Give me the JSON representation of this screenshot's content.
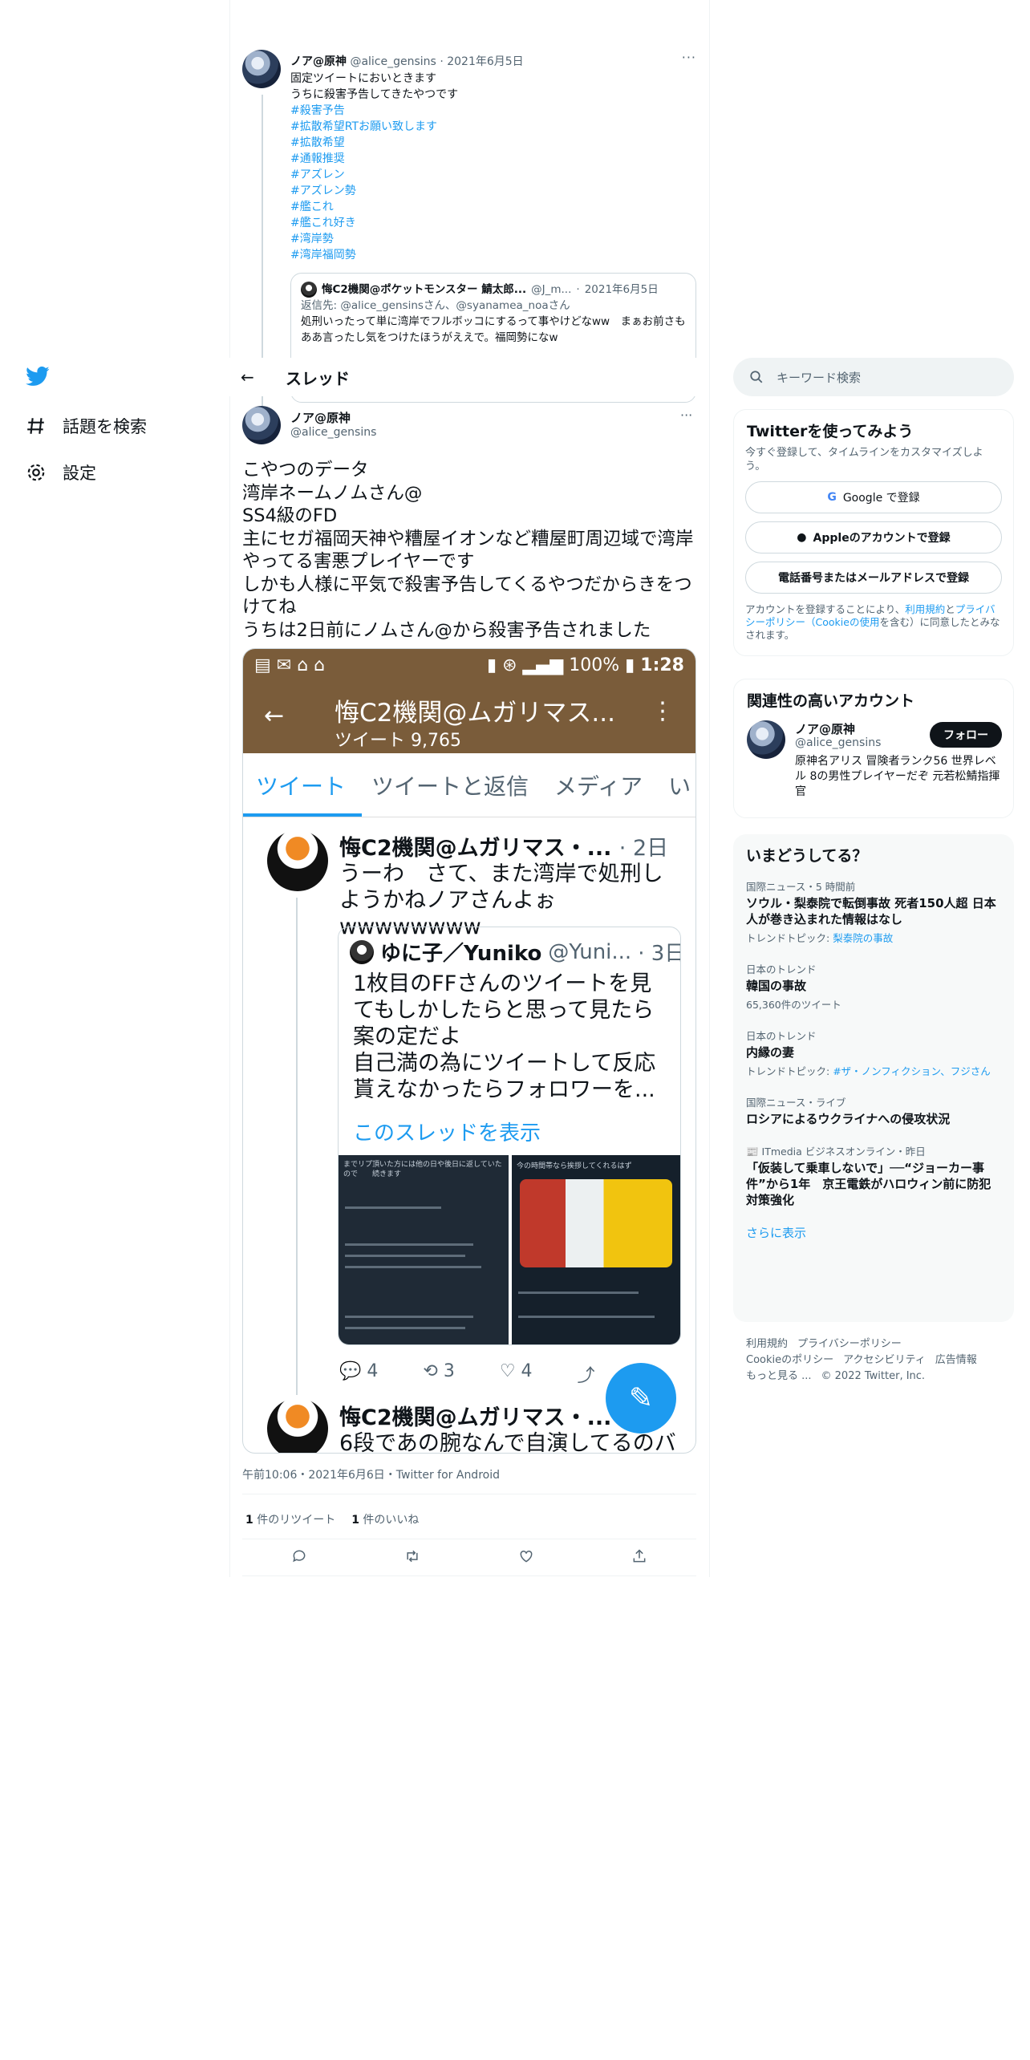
{
  "nav": {
    "items": [
      {
        "label": "話題を検索",
        "icon": "hashtag-icon"
      },
      {
        "label": "設定",
        "icon": "gear-icon"
      }
    ]
  },
  "pinned": {
    "name": "ノア@原神",
    "handle": "@alice_gensins",
    "date": "2021年6月5日",
    "more": "···",
    "lines": [
      "固定ツイートにおいときます",
      "うちに殺害予告してきたやつです"
    ],
    "hashtags": [
      "#殺害予告",
      "#拡散希望RTお願い致します",
      "#拡散希望",
      "#通報推奨",
      "#アズレン",
      "#アズレン勢",
      "#艦これ",
      "#艦これ好き",
      "#湾岸勢",
      "#湾岸福岡勢"
    ],
    "quote": {
      "name": "悔C2機関@ポケットモンスター 鯖太郎...",
      "handle": "@J_m...",
      "date": "2021年6月5日",
      "reply_prefix": "返信先:",
      "reply_to": "@alice_gensinsさん、@syanamea_noaさん",
      "text": "処刑いったって単に湾岸でフルボッコにするって事やけどなww　まぁお前さもああ言ったし気をつけたほうがええで。福岡勢になw"
    }
  },
  "header": {
    "title": "スレッド"
  },
  "main": {
    "name": "ノア@原神",
    "handle": "@alice_gensins",
    "more": "···",
    "text": "こやつのデータ\n湾岸ネームノムさん@\nSS4級のFD\n主にセガ福岡天神や糟屋イオンなど糟屋町周辺域で湾岸やってる害悪プレイヤーです\nしかも人様に平気で殺害予告してくるやつだからきをつけてね\nうちは2日前にノムさん@から殺害予告されました",
    "timestamp": "午前10:06・2021年6月6日・Twitter for Android",
    "retweets": "1",
    "retweets_label": "件のリツイート",
    "likes": "1",
    "likes_label": "件のいいね"
  },
  "screenshot": {
    "battery": "100%",
    "time": "1:28",
    "title": "悔C2機関@ムガリマス...",
    "subtitle": "ツイート 9,765",
    "tabs": [
      "ツイート",
      "ツイートと返信",
      "メディア",
      "い"
    ],
    "tweet_name": "悔C2機関@ムガリマス・...",
    "tweet_age": "· 2日",
    "tweet_text": "うーわ　さて、また湾岸で処刑しようかねノアさんよぉwwwwwwww",
    "quote_name": "ゆに子／Yuniko",
    "quote_handle": "@Yuni...",
    "quote_age": "· 3日",
    "quote_text": "1枚目のFFさんのツイートを見てもしかしたらと思って見たら案の定だよ\n自己満の為にツイートして反応貰えなかったらフォロワーを...",
    "quote_link": "このスレッドを表示",
    "img1_caption": "までリプ頂いた方には他の日や後日に返していたので　　続きます",
    "img2_caption": "今の時間帯なら挨拶してくれるはず",
    "replies": "4",
    "rts": "3",
    "likes": "4",
    "next_name": "悔C2機関@ムガリマス・...",
    "next_text": "6段であの腕なんで自演してるのバ"
  },
  "search": {
    "placeholder": "キーワード検索"
  },
  "signup": {
    "title": "Twitterを使ってみよう",
    "subtitle": "今すぐ登録して、タイムラインをカスタマイズしよう。",
    "google": "Google で登録",
    "apple": "Appleのアカウントで登録",
    "phone": "電話番号またはメールアドレスで登録",
    "terms_pre": "アカウントを登録することにより、",
    "terms_link1": "利用規約",
    "terms_mid": "と",
    "terms_link2": "プライバシーポリシー",
    "terms_link3": "（Cookieの使用",
    "terms_post": "を含む）に同意したとみなされます。"
  },
  "related": {
    "title": "関連性の高いアカウント",
    "name": "ノア@原神",
    "handle": "@alice_gensins",
    "bio": "原神名アリス 冒険者ランク56 世界レベル 8の男性プレイヤーだぞ 元若松鯖指揮官",
    "follow": "フォロー"
  },
  "trends": {
    "title": "いまどうしてる？",
    "items": [
      {
        "context": "国際ニュース・5 時間前",
        "title": "ソウル・梨泰院で転倒事故 死者150人超 日本人が巻き込まれた情報はなし",
        "sub_label": "トレンドトピック: ",
        "sub_link": "梨泰院の事故"
      },
      {
        "context": "日本のトレンド",
        "title": "韓国の事故",
        "sub": "65,360件のツイート"
      },
      {
        "context": "日本のトレンド",
        "title": "内縁の妻",
        "sub_label": "トレンドトピック: ",
        "sub_link": "#ザ・ノンフィクション、フジさん"
      },
      {
        "context": "国際ニュース・ライブ",
        "title": "ロシアによるウクライナへの侵攻状況"
      },
      {
        "context": "ITmedia ビジネスオンライン・昨日",
        "title": "「仮装して乗車しないで」──“ジョーカー事件”から1年　京王電鉄がハロウィン前に防犯対策強化"
      }
    ],
    "show_more": "さらに表示"
  },
  "footer": {
    "links": [
      "利用規約",
      "プライバシーポリシー",
      "Cookieのポリシー",
      "アクセシビリティ",
      "広告情報",
      "もっと見る ..."
    ],
    "copyright": "© 2022 Twitter, Inc."
  }
}
